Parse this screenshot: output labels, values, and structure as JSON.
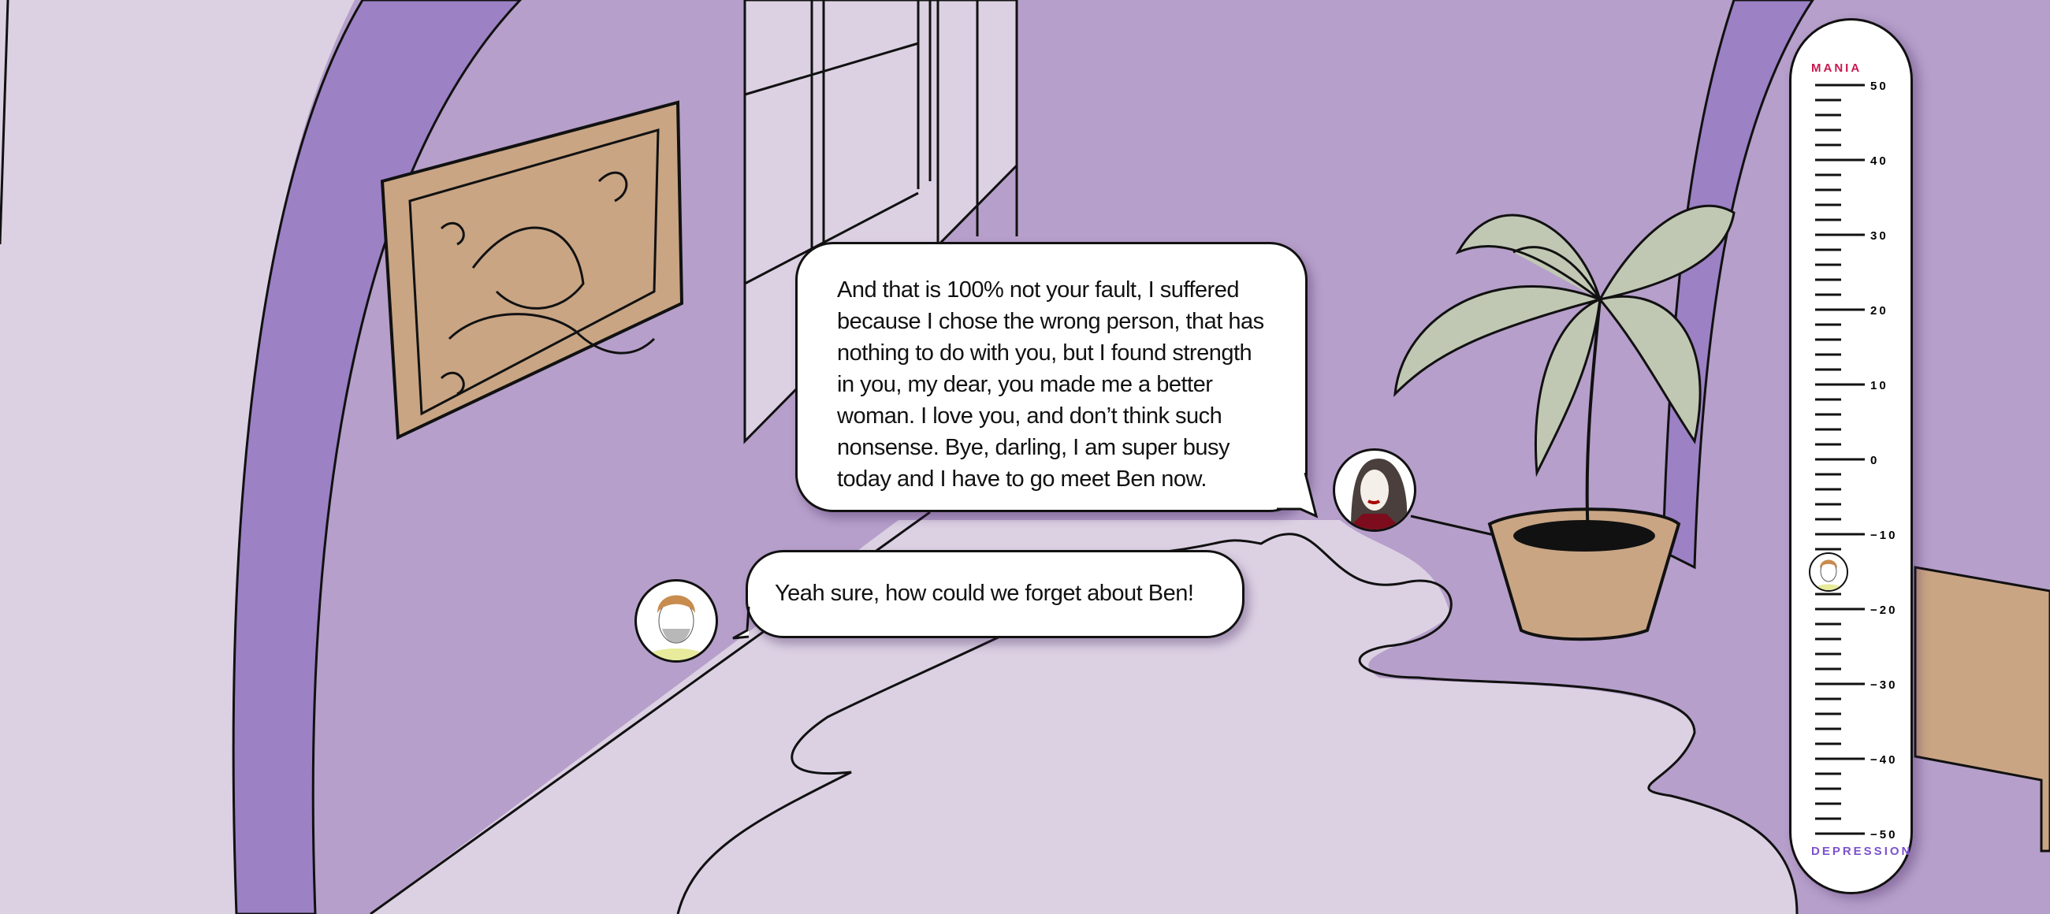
{
  "dialogue": {
    "npc_line": "And that is 100% not your fault, I suffered because I chose the wrong person, that has nothing to do with you, but I found strength in you, my dear, you made me a better woman. I love you, and don’t think such nonsense. Bye, darling, I am super busy today and I have to go meet Ben now.",
    "player_reply": "Yeah sure, how could we forget about Ben!"
  },
  "mood_meter": {
    "top_label": "MANIA",
    "bottom_label": "DEPRESSION",
    "max": 50,
    "min": -50,
    "major_step": 10,
    "minor_step": 2,
    "tick_labels": [
      "50",
      "40",
      "30",
      "20",
      "10",
      "0",
      "−10",
      "−20",
      "−30",
      "−40",
      "−50"
    ],
    "current_value": -15,
    "top_color": "#c8174f",
    "bottom_color": "#7b52cc"
  },
  "colors": {
    "wall": "#b69fca",
    "floor": "#dbd0e2",
    "arch": "#9b80c4",
    "wood": "#c9a584",
    "plant": "#c0c8b4"
  }
}
